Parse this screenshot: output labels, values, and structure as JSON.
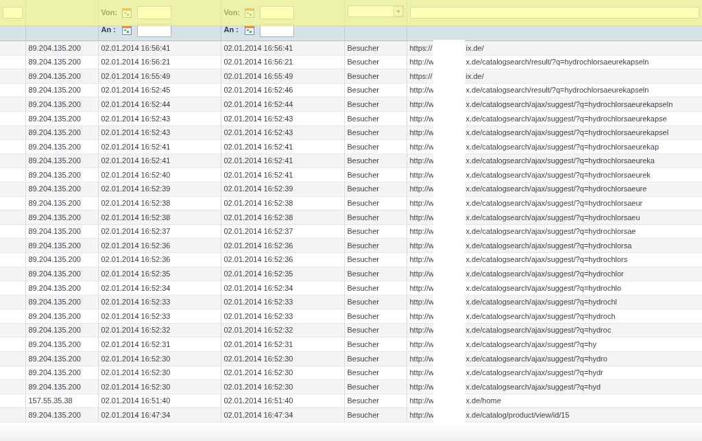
{
  "filters": {
    "date_from_label_1": "Von:",
    "date_to_label_1": "An :",
    "date_from_label_2": "Von:",
    "date_to_label_2": "An :"
  },
  "rows": [
    {
      "ip": "89.204.135.200",
      "first_visit": "02.01.2014 16:56:41",
      "last_visit": "02.01.2014 16:56:41",
      "type": "Besucher",
      "url_start": "https://",
      "url_end": "ix.de/"
    },
    {
      "ip": "89.204.135.200",
      "first_visit": "02.01.2014 16:56:21",
      "last_visit": "02.01.2014 16:56:21",
      "type": "Besucher",
      "url_start": "http://w",
      "url_end": "x.de/catalogsearch/result/?q=hydrochlorsaeurekapseln"
    },
    {
      "ip": "89.204.135.200",
      "first_visit": "02.01.2014 16:55:49",
      "last_visit": "02.01.2014 16:55:49",
      "type": "Besucher",
      "url_start": "https://",
      "url_end": "ix.de/"
    },
    {
      "ip": "89.204.135.200",
      "first_visit": "02.01.2014 16:52:45",
      "last_visit": "02.01.2014 16:52:46",
      "type": "Besucher",
      "url_start": "http://w",
      "url_end": "x.de/catalogsearch/result/?q=hydrochlorsaeurekapseln"
    },
    {
      "ip": "89.204.135.200",
      "first_visit": "02.01.2014 16:52:44",
      "last_visit": "02.01.2014 16:52:44",
      "type": "Besucher",
      "url_start": "http://w",
      "url_end": "x.de/catalogsearch/ajax/suggest/?q=hydrochlorsaeurekapseln"
    },
    {
      "ip": "89.204.135.200",
      "first_visit": "02.01.2014 16:52:43",
      "last_visit": "02.01.2014 16:52:43",
      "type": "Besucher",
      "url_start": "http://w",
      "url_end": "x.de/catalogsearch/ajax/suggest/?q=hydrochlorsaeurekapse"
    },
    {
      "ip": "89.204.135.200",
      "first_visit": "02.01.2014 16:52:43",
      "last_visit": "02.01.2014 16:52:43",
      "type": "Besucher",
      "url_start": "http://w",
      "url_end": "x.de/catalogsearch/ajax/suggest/?q=hydrochlorsaeurekapsel"
    },
    {
      "ip": "89.204.135.200",
      "first_visit": "02.01.2014 16:52:41",
      "last_visit": "02.01.2014 16:52:41",
      "type": "Besucher",
      "url_start": "http://w",
      "url_end": "x.de/catalogsearch/ajax/suggest/?q=hydrochlorsaeurekap"
    },
    {
      "ip": "89.204.135.200",
      "first_visit": "02.01.2014 16:52:41",
      "last_visit": "02.01.2014 16:52:41",
      "type": "Besucher",
      "url_start": "http://w",
      "url_end": "x.de/catalogsearch/ajax/suggest/?q=hydrochlorsaeureka"
    },
    {
      "ip": "89.204.135.200",
      "first_visit": "02.01.2014 16:52:40",
      "last_visit": "02.01.2014 16:52:41",
      "type": "Besucher",
      "url_start": "http://w",
      "url_end": "x.de/catalogsearch/ajax/suggest/?q=hydrochlorsaeurek"
    },
    {
      "ip": "89.204.135.200",
      "first_visit": "02.01.2014 16:52:39",
      "last_visit": "02.01.2014 16:52:39",
      "type": "Besucher",
      "url_start": "http://w",
      "url_end": "x.de/catalogsearch/ajax/suggest/?q=hydrochlorsaeure"
    },
    {
      "ip": "89.204.135.200",
      "first_visit": "02.01.2014 16:52:38",
      "last_visit": "02.01.2014 16:52:38",
      "type": "Besucher",
      "url_start": "http://w",
      "url_end": "x.de/catalogsearch/ajax/suggest/?q=hydrochlorsaeur"
    },
    {
      "ip": "89.204.135.200",
      "first_visit": "02.01.2014 16:52:38",
      "last_visit": "02.01.2014 16:52:38",
      "type": "Besucher",
      "url_start": "http://w",
      "url_end": "x.de/catalogsearch/ajax/suggest/?q=hydrochlorsaeu"
    },
    {
      "ip": "89.204.135.200",
      "first_visit": "02.01.2014 16:52:37",
      "last_visit": "02.01.2014 16:52:37",
      "type": "Besucher",
      "url_start": "http://w",
      "url_end": "x.de/catalogsearch/ajax/suggest/?q=hydrochlorsae"
    },
    {
      "ip": "89.204.135.200",
      "first_visit": "02.01.2014 16:52:36",
      "last_visit": "02.01.2014 16:52:36",
      "type": "Besucher",
      "url_start": "http://w",
      "url_end": "x.de/catalogsearch/ajax/suggest/?q=hydrochlorsa"
    },
    {
      "ip": "89.204.135.200",
      "first_visit": "02.01.2014 16:52:36",
      "last_visit": "02.01.2014 16:52:36",
      "type": "Besucher",
      "url_start": "http://w",
      "url_end": "x.de/catalogsearch/ajax/suggest/?q=hydrochlors"
    },
    {
      "ip": "89.204.135.200",
      "first_visit": "02.01.2014 16:52:35",
      "last_visit": "02.01.2014 16:52:35",
      "type": "Besucher",
      "url_start": "http://w",
      "url_end": "x.de/catalogsearch/ajax/suggest/?q=hydrochlor"
    },
    {
      "ip": "89.204.135.200",
      "first_visit": "02.01.2014 16:52:34",
      "last_visit": "02.01.2014 16:52:34",
      "type": "Besucher",
      "url_start": "http://w",
      "url_end": "x.de/catalogsearch/ajax/suggest/?q=hydrochlo"
    },
    {
      "ip": "89.204.135.200",
      "first_visit": "02.01.2014 16:52:33",
      "last_visit": "02.01.2014 16:52:33",
      "type": "Besucher",
      "url_start": "http://w",
      "url_end": "x.de/catalogsearch/ajax/suggest/?q=hydrochl"
    },
    {
      "ip": "89.204.135.200",
      "first_visit": "02.01.2014 16:52:33",
      "last_visit": "02.01.2014 16:52:33",
      "type": "Besucher",
      "url_start": "http://w",
      "url_end": "x.de/catalogsearch/ajax/suggest/?q=hydroch"
    },
    {
      "ip": "89.204.135.200",
      "first_visit": "02.01.2014 16:52:32",
      "last_visit": "02.01.2014 16:52:32",
      "type": "Besucher",
      "url_start": "http://w",
      "url_end": "x.de/catalogsearch/ajax/suggest/?q=hydroc"
    },
    {
      "ip": "89.204.135.200",
      "first_visit": "02.01.2014 16:52:31",
      "last_visit": "02.01.2014 16:52:31",
      "type": "Besucher",
      "url_start": "http://w",
      "url_end": "x.de/catalogsearch/ajax/suggest/?q=hy"
    },
    {
      "ip": "89.204.135.200",
      "first_visit": "02.01.2014 16:52:30",
      "last_visit": "02.01.2014 16:52:30",
      "type": "Besucher",
      "url_start": "http://w",
      "url_end": "x.de/catalogsearch/ajax/suggest/?q=hydro"
    },
    {
      "ip": "89.204.135.200",
      "first_visit": "02.01.2014 16:52:30",
      "last_visit": "02.01.2014 16:52:30",
      "type": "Besucher",
      "url_start": "http://w",
      "url_end": "x.de/catalogsearch/ajax/suggest/?q=hydr"
    },
    {
      "ip": "89.204.135.200",
      "first_visit": "02.01.2014 16:52:30",
      "last_visit": "02.01.2014 16:52:30",
      "type": "Besucher",
      "url_start": "http://w",
      "url_end": "x.de/catalogsearch/ajax/suggest/?q=hyd"
    },
    {
      "ip": "157.55.35.38",
      "first_visit": "02.01.2014 16:51:40",
      "last_visit": "02.01.2014 16:51:40",
      "type": "Besucher",
      "url_start": "http://w",
      "url_end": "x.de/home"
    },
    {
      "ip": "89.204.135.200",
      "first_visit": "02.01.2014 16:47:34",
      "last_visit": "02.01.2014 16:47:34",
      "type": "Besucher",
      "url_start": "http://w",
      "url_end": "x.de/catalog/product/view/id/15"
    }
  ]
}
